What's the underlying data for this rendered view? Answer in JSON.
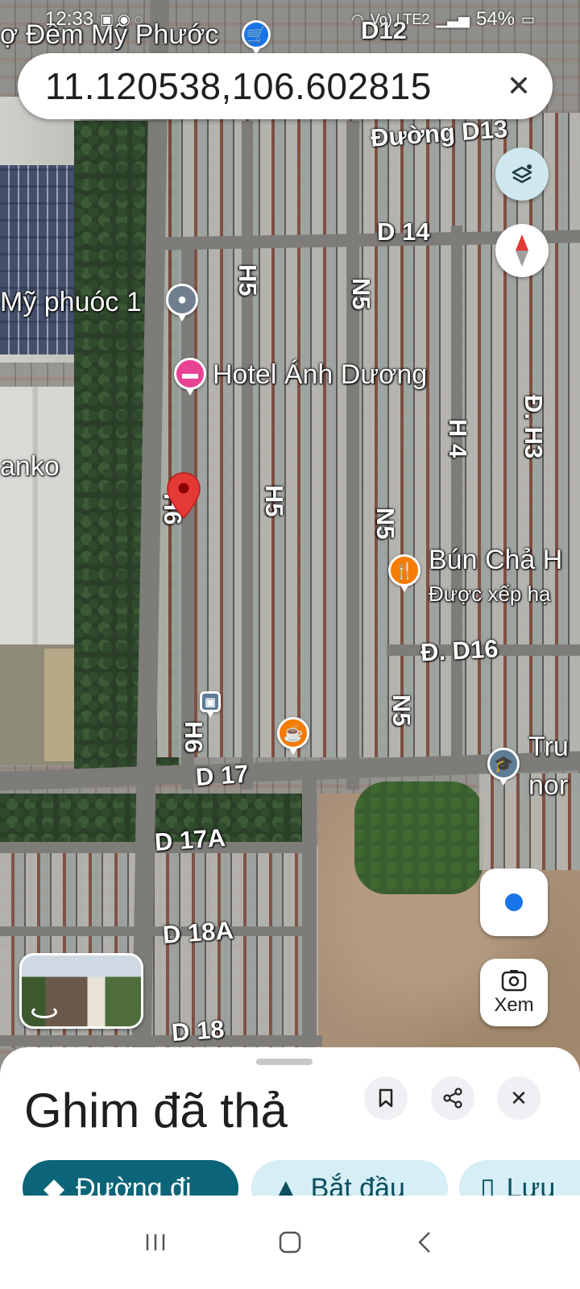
{
  "status_bar": {
    "time": "12:33",
    "network": "Vo) LTE2",
    "battery": "54%"
  },
  "search": {
    "coordinates": "11.120538,106.602815",
    "close_icon": "close-icon"
  },
  "map": {
    "poi_top": "ợ Đêm Mỹ Phước",
    "road_labels": {
      "d12": "D12",
      "d13": "Đường D13",
      "d14": "D 14",
      "h5_top": "H5",
      "n5_top": "N5",
      "h5_mid": "H5",
      "h4": "H 4",
      "dh3": "Đ. H3",
      "n5_mid": "N5",
      "h6_top": "H6",
      "dd16": "Đ. D16",
      "n5_bottom": "N5",
      "h6_bottom": "H6",
      "d17": "D 17",
      "d17a": "D 17A",
      "d18a": "D 18A",
      "d18": "D 18"
    },
    "places": {
      "my_phuoc": "Mỹ phuóc 1",
      "hotel": "Hotel Ánh Dương",
      "sanko": "anko",
      "bun_cha": "Bún Chả H",
      "bun_cha_sub": "Được xếp hạ",
      "school_line1": "Tru",
      "school_line2": "nor"
    },
    "lens_label": "Xem"
  },
  "sheet": {
    "title": "Ghim đã thả",
    "actions": {
      "directions": "Đường đi",
      "start": "Bắt đầu",
      "save": "Lưu"
    }
  },
  "colors": {
    "accent": "#0b6477",
    "chip_light": "#d6eef5",
    "pin": "#e53935",
    "hotel_poi": "#e84393",
    "food_poi": "#f57c00",
    "school_poi": "#5f7d95"
  }
}
